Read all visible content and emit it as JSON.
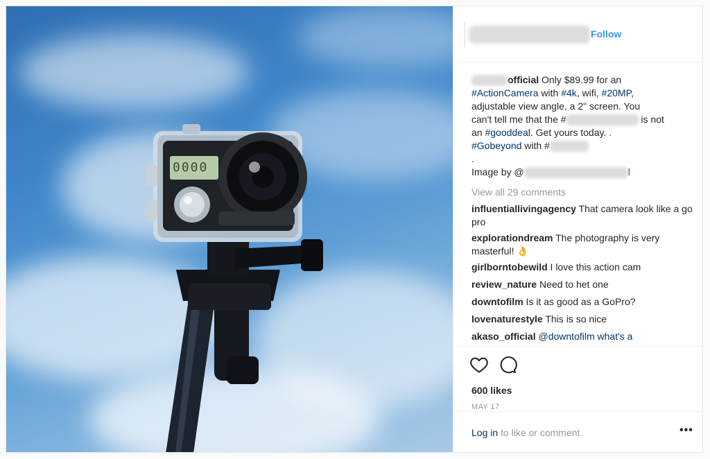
{
  "post": {
    "header": {
      "follow_label": "Follow"
    },
    "camera_screen": "0000",
    "caption": {
      "username_suffix": "official",
      "text_1": " Only $89.99 for an",
      "tag_action": "#ActionCamera",
      "text_with": " with ",
      "tag_4k": "#4k",
      "text_wifi": ", wifi, ",
      "tag_20mp": "#20MP",
      "text_comma": ",",
      "line_3": "adjustable view angle, a 2\" screen. You",
      "line_4a": "can't tell me that the #",
      "line_4b": " is not",
      "line_5a": "an ",
      "tag_gooddeal": "#gooddeal",
      "line_5b": ". Get yours today. .",
      "tag_gobeyond": "#Gobeyond",
      "line_6b": " with #",
      "line_7": ".",
      "image_by_a": "Image by @",
      "image_by_b": "l"
    },
    "view_all": "View all 29 comments",
    "comments": [
      {
        "user": "influentiallivingagency",
        "text": " That camera look like a go pro"
      },
      {
        "user": "explorationdream",
        "text": " The photography is very masterful! 👌"
      },
      {
        "user": "girlborntobewild",
        "text": " I love this action cam"
      },
      {
        "user": "review_nature",
        "text": " Need to het one"
      },
      {
        "user": "downtofilm",
        "text": " Is it as good as a GoPro?"
      },
      {
        "user": "lovenaturestyle",
        "text": " This is so nice"
      },
      {
        "user": "akaso_official",
        "text": " @downtofilm what's a"
      }
    ],
    "likes": "600 likes",
    "date": "MAY 17",
    "footer": {
      "login_link": "Log in",
      "login_rest": " to like or comment.",
      "more": "•••"
    },
    "icons": {
      "like": "heart-icon",
      "comment": "comment-bubble-icon",
      "more": "more-options-icon"
    }
  }
}
